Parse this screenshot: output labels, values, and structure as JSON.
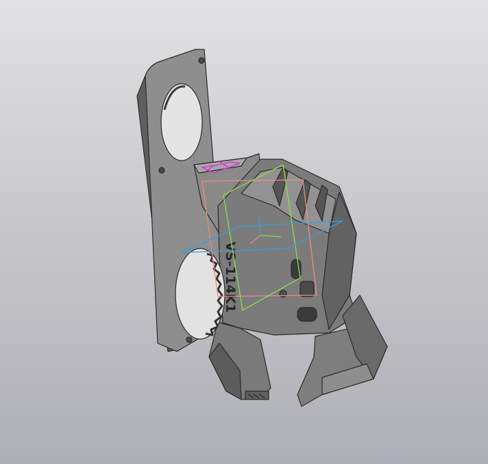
{
  "viewport": {
    "background_top": "#e2e2e4",
    "background_bottom": "#aeaeb6"
  },
  "model": {
    "engraving_text": "VS-114K1",
    "colors": {
      "body_light": "#8e8e8e",
      "body_mid": "#7b7b7b",
      "body_dark": "#5f5f5f",
      "edge": "#2a2a2a",
      "plane_front": "#ee8a8a",
      "plane_side": "#8ee043",
      "plane_top": "#3a9be0",
      "axis_sketch": "#d533d5"
    }
  }
}
